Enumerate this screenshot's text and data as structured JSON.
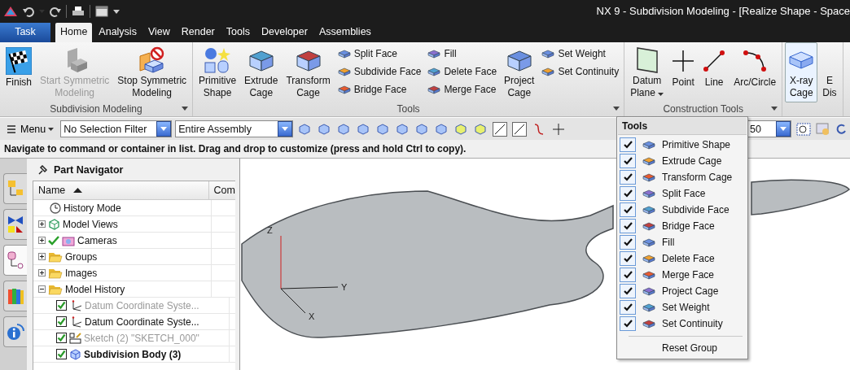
{
  "window": {
    "title": "NX 9 - Subdivision Modeling - [Realize Shape - Space"
  },
  "tabs": [
    {
      "label": "Task",
      "kind": "task",
      "selected": false
    },
    {
      "label": "Home",
      "kind": "tab",
      "selected": true
    },
    {
      "label": "Analysis",
      "kind": "tab",
      "selected": false
    },
    {
      "label": "View",
      "kind": "tab",
      "selected": false
    },
    {
      "label": "Render",
      "kind": "tab",
      "selected": false
    },
    {
      "label": "Tools",
      "kind": "tab",
      "selected": false
    },
    {
      "label": "Developer",
      "kind": "tab",
      "selected": false
    },
    {
      "label": "Assemblies",
      "kind": "tab",
      "selected": false
    }
  ],
  "ribbon": {
    "groups": [
      {
        "label": "Subdivision Modeling",
        "launcher": true,
        "columns": [
          {
            "kind": "large",
            "items": [
              {
                "label": [
                  "Finish"
                ],
                "disabled": false
              }
            ]
          },
          {
            "kind": "large",
            "items": [
              {
                "label": [
                  "Start Symmetric",
                  "Modeling"
                ],
                "disabled": true
              }
            ]
          },
          {
            "kind": "large",
            "items": [
              {
                "label": [
                  "Stop Symmetric",
                  "Modeling"
                ],
                "disabled": false
              }
            ]
          }
        ]
      },
      {
        "label": "Tools",
        "launcher": true,
        "columns": [
          {
            "kind": "large",
            "items": [
              {
                "label": [
                  "Primitive",
                  "Shape"
                ],
                "disabled": false
              }
            ]
          },
          {
            "kind": "large",
            "items": [
              {
                "label": [
                  "Extrude",
                  "Cage"
                ],
                "disabled": false
              }
            ]
          },
          {
            "kind": "large",
            "items": [
              {
                "label": [
                  "Transform",
                  "Cage"
                ],
                "disabled": false
              }
            ]
          },
          {
            "kind": "stack",
            "items": [
              {
                "label": [
                  "Split Face"
                ],
                "disabled": false
              },
              {
                "label": [
                  "Subdivide Face"
                ],
                "disabled": false
              },
              {
                "label": [
                  "Bridge Face"
                ],
                "disabled": false
              }
            ]
          },
          {
            "kind": "stack",
            "items": [
              {
                "label": [
                  "Fill"
                ],
                "disabled": false
              },
              {
                "label": [
                  "Delete Face"
                ],
                "disabled": false
              },
              {
                "label": [
                  "Merge Face"
                ],
                "disabled": false
              }
            ]
          },
          {
            "kind": "large",
            "items": [
              {
                "label": [
                  "Project",
                  "Cage"
                ],
                "disabled": false
              }
            ]
          },
          {
            "kind": "stack",
            "items": [
              {
                "label": [
                  "Set Weight"
                ],
                "disabled": false
              },
              {
                "label": [
                  "Set Continuity"
                ],
                "disabled": false
              }
            ]
          }
        ]
      },
      {
        "label": "Construction Tools",
        "launcher": true,
        "columns": [
          {
            "kind": "large",
            "items": [
              {
                "label": [
                  "Datum",
                  "Plane"
                ],
                "disabled": false,
                "dropdown": true
              }
            ]
          },
          {
            "kind": "large",
            "items": [
              {
                "label": [
                  "Point"
                ],
                "disabled": false
              }
            ]
          },
          {
            "kind": "large",
            "items": [
              {
                "label": [
                  "Line"
                ],
                "disabled": false
              }
            ]
          },
          {
            "kind": "large",
            "items": [
              {
                "label": [
                  "Arc/Circle"
                ],
                "disabled": false
              }
            ]
          }
        ]
      },
      {
        "columns": [
          {
            "kind": "large",
            "items": [
              {
                "label": [
                  "X-ray",
                  "Cage"
                ],
                "disabled": false,
                "on": true
              }
            ]
          },
          {
            "kind": "large",
            "items": [
              {
                "label": [
                  "E",
                  "Dis"
                ],
                "disabled": false,
                "on": false
              }
            ]
          }
        ]
      }
    ]
  },
  "toolbar": {
    "menu": "Menu",
    "selection_filter": "No Selection Filter",
    "scope": "Entire Assembly",
    "value": "50"
  },
  "status_bar": "Navigate to command or container in list. Drag and drop to customize (press and hold Ctrl to copy).",
  "nav_tabs": [
    {
      "selected": false
    },
    {
      "selected": false
    },
    {
      "selected": true
    },
    {
      "selected": false
    },
    {
      "selected": false
    }
  ],
  "navigator": {
    "title": "Part Navigator",
    "columns": [
      "Name",
      "Com"
    ],
    "rows": [
      {
        "label": "History Mode",
        "kind": "history"
      },
      {
        "label": "Model Views",
        "kind": "views",
        "expanded": false
      },
      {
        "label": "Cameras",
        "kind": "cameras",
        "expanded": false,
        "checked": true
      },
      {
        "label": "Groups",
        "kind": "folder",
        "expanded": false
      },
      {
        "label": "Images",
        "kind": "folder",
        "expanded": false
      },
      {
        "label": "Model History",
        "kind": "folder",
        "expanded": true,
        "children": [
          {
            "label": "Datum Coordinate Syste...",
            "kind": "datum",
            "checked": true,
            "dimmed": true,
            "current": false
          },
          {
            "label": "Datum Coordinate Syste...",
            "kind": "datum",
            "checked": true,
            "dimmed": false,
            "current": false
          },
          {
            "label": "Sketch (2) \"SKETCH_000\"",
            "kind": "sketch",
            "checked": true,
            "dimmed": true,
            "current": false
          },
          {
            "label": "Subdivision Body (3)",
            "kind": "body",
            "checked": true,
            "dimmed": false,
            "current": true
          }
        ]
      }
    ]
  },
  "viewport": {
    "axis_labels": [
      "Z",
      "Y",
      "X"
    ]
  },
  "popup_menu": {
    "title": "Tools",
    "items": [
      {
        "label": "Primitive Shape",
        "checked": true
      },
      {
        "label": "Extrude Cage",
        "checked": true
      },
      {
        "label": "Transform Cage",
        "checked": true
      },
      {
        "label": "Split Face",
        "checked": true
      },
      {
        "label": "Subdivide Face",
        "checked": true
      },
      {
        "label": "Bridge Face",
        "checked": true
      },
      {
        "label": "Fill",
        "checked": true
      },
      {
        "label": "Delete Face",
        "checked": true
      },
      {
        "label": "Merge Face",
        "checked": true
      },
      {
        "label": "Project Cage",
        "checked": true
      },
      {
        "label": "Set Weight",
        "checked": true
      },
      {
        "label": "Set Continuity",
        "checked": true
      }
    ],
    "footer": "Reset Group"
  }
}
